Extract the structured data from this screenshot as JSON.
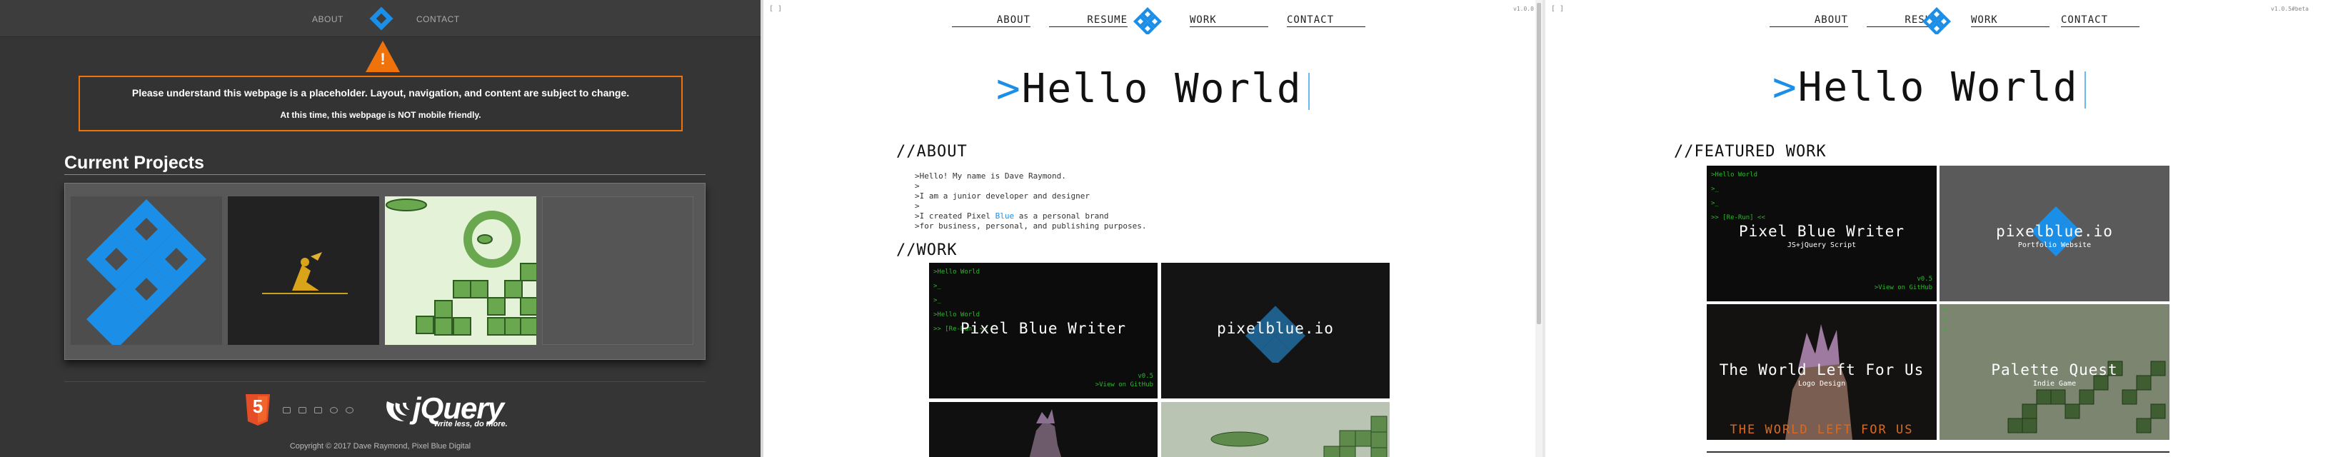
{
  "panel1": {
    "nav": {
      "about": "ABOUT",
      "contact": "CONTACT"
    },
    "notice": {
      "line1": "Please understand this webpage is a placeholder. Layout, navigation, and content are subject to change.",
      "line2": "At this time, this webpage is NOT mobile friendly."
    },
    "projects_title": "Current Projects",
    "footer": {
      "html5_number": "5",
      "jquery_word": "jQuery",
      "jquery_tagline": "write less, do more.",
      "copyright": "Copyright © 2017 Dave Raymond, Pixel Blue Digital"
    },
    "colors": {
      "accent": "#f0720a",
      "brand_blue": "#1b8fe8",
      "background": "#353535"
    }
  },
  "panel2": {
    "corner_left": "[ ]",
    "version": "v1.0.0",
    "nav": {
      "about": "ABOUT",
      "resume": "RESUME",
      "work": "WORK",
      "contact": "CONTACT"
    },
    "hero": {
      "prompt": ">",
      "text": "Hello World"
    },
    "about_heading": "//ABOUT",
    "about_lines": [
      ">Hello! My name is Dave Raymond.",
      ">",
      ">I am a junior developer and designer",
      ">",
      ">I created Pixel Blue as a personal brand",
      ">for business, personal, and publishing purposes."
    ],
    "about_highlight": "Blue",
    "work_heading": "//WORK",
    "cards": [
      {
        "title": "Pixel Blue Writer",
        "code": ">Hello World\n\n>_\n\n>_\n\n>Hello World\n\n>> [Re-Run] <<",
        "meta1": "v0.5",
        "meta2": ">View on GitHub"
      },
      {
        "title": "pixelblue.io"
      }
    ]
  },
  "panel3": {
    "corner_left": "[ ]",
    "version": "v1.0.5#beta",
    "nav": {
      "about": "ABOUT",
      "resume": "RESUME",
      "work": "WORK",
      "contact": "CONTACT"
    },
    "hero": {
      "prompt": ">",
      "text": "Hello World"
    },
    "featured_heading": "//FEATURED WORK",
    "cards": [
      {
        "title": "Pixel Blue Writer",
        "sub": "JS+jQuery Script",
        "code": ">Hello World\n\n>_\n\n>_\n\n>> [Re-Run] <<",
        "meta1": "v0.5",
        "meta2": ">View on GitHub"
      },
      {
        "title": "pixelblue.io",
        "sub": "Portfolio Website"
      },
      {
        "title": "The World Left For Us",
        "sub": "Logo Design",
        "banner": "THE WORLD LEFT FOR US"
      },
      {
        "title": "Palette Quest",
        "sub": "Indie Game"
      }
    ]
  }
}
